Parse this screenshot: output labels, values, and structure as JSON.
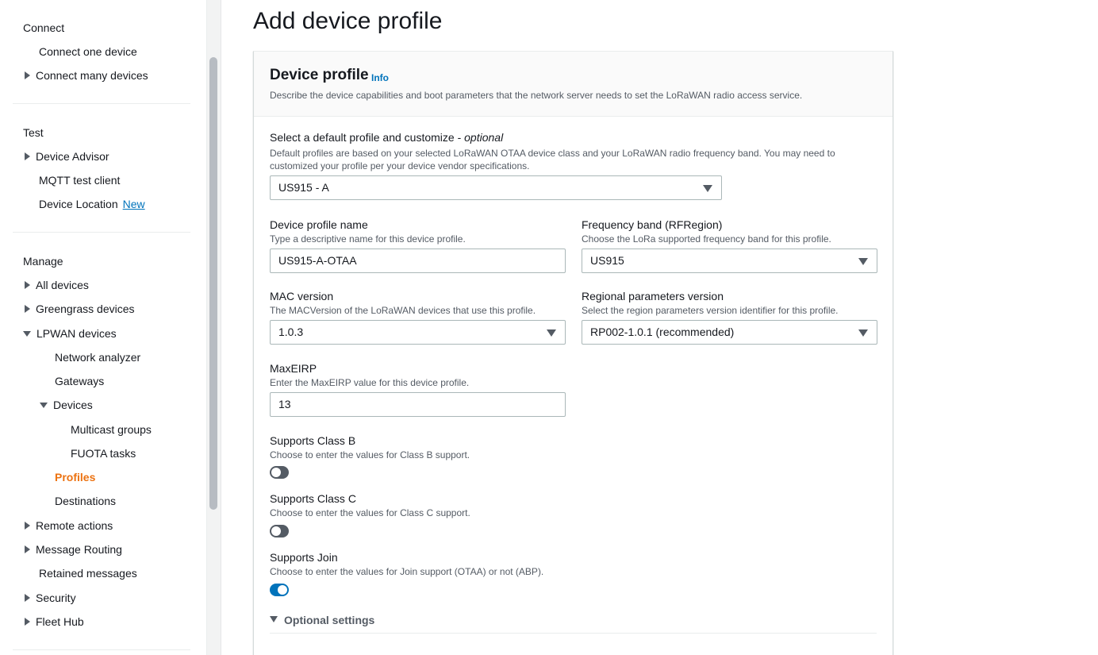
{
  "sidebar": {
    "connect": {
      "heading": "Connect",
      "items": [
        {
          "label": "Connect one device"
        },
        {
          "label": "Connect many devices"
        }
      ]
    },
    "test": {
      "heading": "Test",
      "items": [
        {
          "label": "Device Advisor"
        },
        {
          "label": "MQTT test client"
        },
        {
          "label": "Device Location",
          "badge": "New"
        }
      ]
    },
    "manage": {
      "heading": "Manage",
      "items": [
        {
          "label": "All devices"
        },
        {
          "label": "Greengrass devices"
        },
        {
          "label": "LPWAN devices"
        },
        {
          "label": "Network analyzer"
        },
        {
          "label": "Gateways"
        },
        {
          "label": "Devices"
        },
        {
          "label": "Multicast groups"
        },
        {
          "label": "FUOTA tasks"
        },
        {
          "label": "Profiles"
        },
        {
          "label": "Destinations"
        },
        {
          "label": "Remote actions"
        },
        {
          "label": "Message Routing"
        },
        {
          "label": "Retained messages"
        },
        {
          "label": "Security"
        },
        {
          "label": "Fleet Hub"
        }
      ]
    }
  },
  "page": {
    "title": "Add device profile"
  },
  "panel": {
    "title": "Device profile",
    "info": "Info",
    "description": "Describe the device capabilities and boot parameters that the network server needs to set the LoRaWAN radio access service."
  },
  "form": {
    "default_profile": {
      "label": "Select a default profile and customize - ",
      "label_optional": "optional",
      "description": "Default profiles are based on your selected LoRaWAN OTAA device class and your LoRaWAN radio frequency band. You may need to customized your profile per your device vendor specifications.",
      "value": "US915 - A"
    },
    "profile_name": {
      "label": "Device profile name",
      "description": "Type a descriptive name for this device profile.",
      "value": "US915-A-OTAA"
    },
    "frequency_band": {
      "label": "Frequency band (RFRegion)",
      "description": "Choose the LoRa supported frequency band for this profile.",
      "value": "US915"
    },
    "mac_version": {
      "label": "MAC version",
      "description": "The MACVersion of the LoRaWAN devices that use this profile.",
      "value": "1.0.3"
    },
    "regional_params": {
      "label": "Regional parameters version",
      "description": "Select the region parameters version identifier for this profile.",
      "value": "RP002-1.0.1 (recommended)"
    },
    "max_eirp": {
      "label": "MaxEIRP",
      "description": "Enter the MaxEIRP value for this device profile.",
      "value": "13"
    },
    "class_b": {
      "label": "Supports Class B",
      "description": "Choose to enter the values for Class B support.",
      "enabled": false
    },
    "class_c": {
      "label": "Supports Class C",
      "description": "Choose to enter the values for Class C support.",
      "enabled": false
    },
    "join": {
      "label": "Supports Join",
      "description": "Choose to enter the values for Join support (OTAA) or not (ABP).",
      "enabled": true
    },
    "optional_settings": {
      "label": "Optional settings"
    }
  },
  "colors": {
    "accent": "#0073bb",
    "active_nav": "#ec7211"
  }
}
